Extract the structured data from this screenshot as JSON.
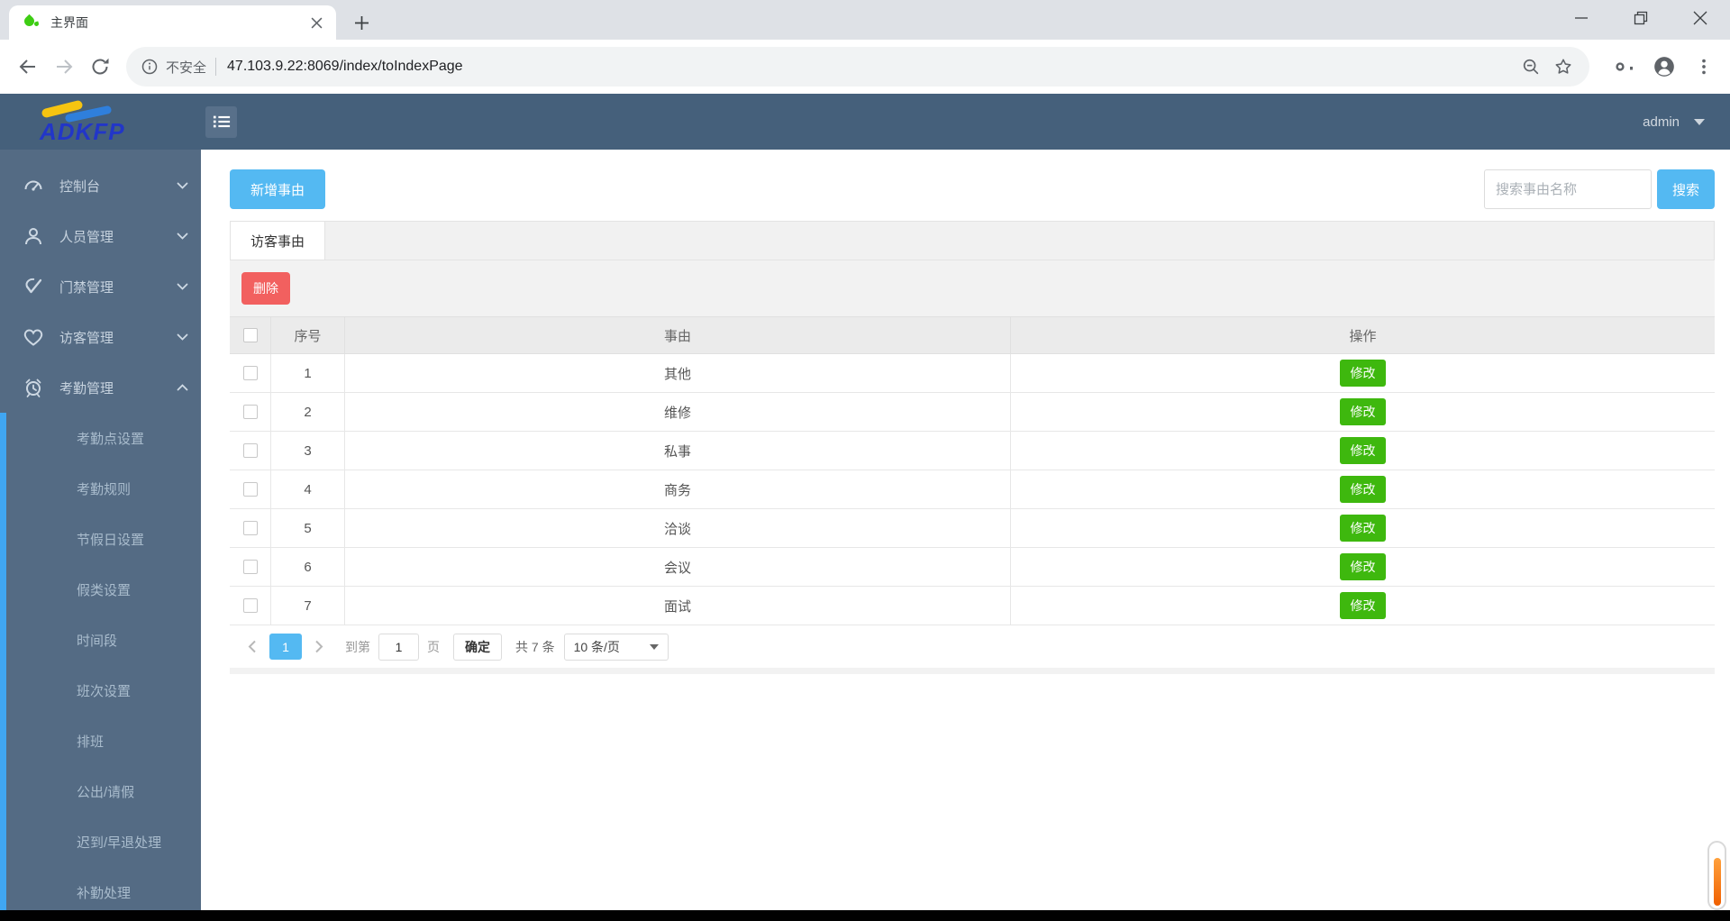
{
  "browser": {
    "tab_title": "主界面",
    "security_label": "不安全",
    "url": "47.103.9.22:8069/index/toIndexPage"
  },
  "header": {
    "logo_text": "ADKFP",
    "user": "admin"
  },
  "sidebar": {
    "items": [
      {
        "label": "控制台",
        "icon": "console-icon"
      },
      {
        "label": "人员管理",
        "icon": "person-icon"
      },
      {
        "label": "门禁管理",
        "icon": "access-check-icon"
      },
      {
        "label": "访客管理",
        "icon": "heart-icon"
      },
      {
        "label": "考勤管理",
        "icon": "alarm-clock-icon"
      }
    ],
    "submenu": [
      "考勤点设置",
      "考勤规则",
      "节假日设置",
      "假类设置",
      "时间段",
      "班次设置",
      "排班",
      "公出/请假",
      "迟到/早退处理",
      "补勤处理"
    ]
  },
  "content": {
    "add_button": "新增事由",
    "search_placeholder": "搜索事由名称",
    "search_button": "搜索",
    "active_tab": "访客事由",
    "delete_button": "删除"
  },
  "table": {
    "columns": [
      "序号",
      "事由",
      "操作"
    ],
    "modify_label": "修改",
    "rows": [
      {
        "no": "1",
        "reason": "其他"
      },
      {
        "no": "2",
        "reason": "维修"
      },
      {
        "no": "3",
        "reason": "私事"
      },
      {
        "no": "4",
        "reason": "商务"
      },
      {
        "no": "5",
        "reason": "洽谈"
      },
      {
        "no": "6",
        "reason": "会议"
      },
      {
        "no": "7",
        "reason": "面试"
      }
    ]
  },
  "pagination": {
    "current_page": "1",
    "goto_label": "到第",
    "goto_value": "1",
    "page_unit": "页",
    "confirm_label": "确定",
    "total_label": "共 7 条",
    "page_size": "10 条/页"
  },
  "colors": {
    "accent_blue": "#54b9f2",
    "danger_red": "#f2605f",
    "success_green": "#3eb80e",
    "header_bg": "#45607b",
    "sidebar_bg": "#546b84",
    "submenu_indicator": "#40a6f2",
    "scroll_orange": "#f06000",
    "favicon_green": "#3ecd14"
  },
  "icons": {
    "favicon": "droplet-icon",
    "hamburger": "list-menu-icon",
    "address_left": "info-icon",
    "address_right": [
      "zoom-out-icon",
      "bookmark-star-icon"
    ],
    "toolbar_right": [
      "key-icon",
      "profile-icon",
      "menu-dots-icon"
    ],
    "window": [
      "minimize-icon",
      "restore-icon",
      "close-icon"
    ]
  }
}
